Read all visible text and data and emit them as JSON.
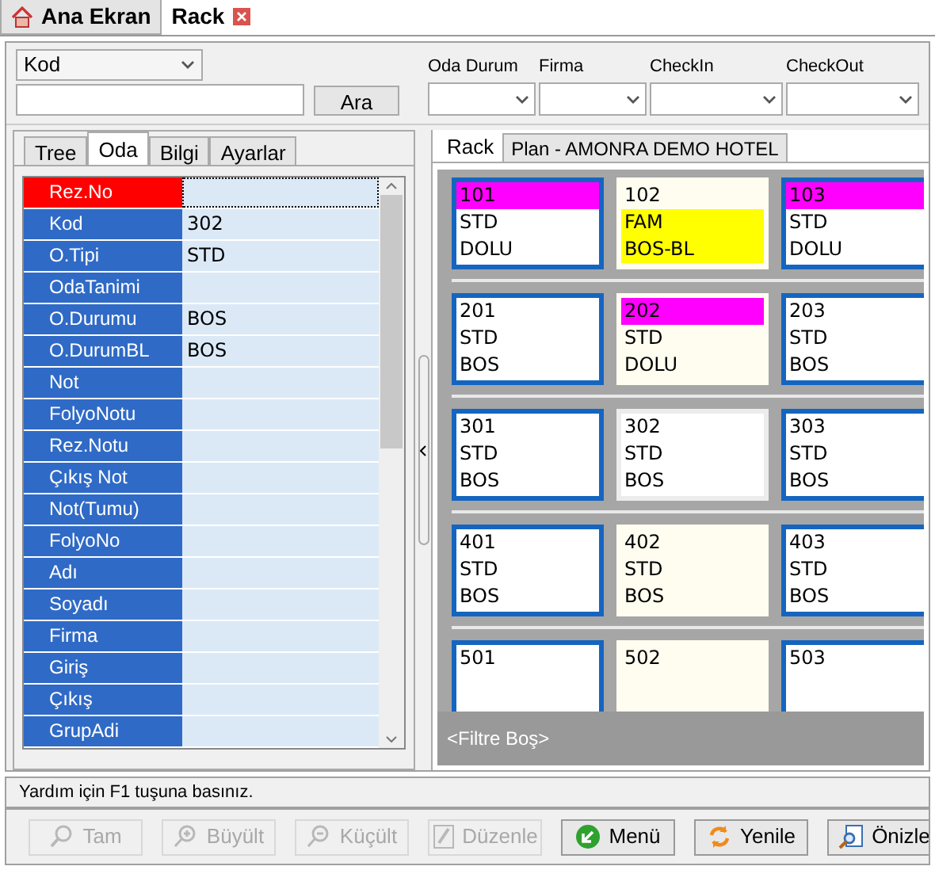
{
  "doc_tabs": [
    {
      "label": "Ana Ekran",
      "selected": false,
      "closable": false
    },
    {
      "label": "Rack",
      "selected": true,
      "closable": true
    }
  ],
  "search": {
    "field_select": "Kod",
    "button": "Ara"
  },
  "filters": [
    {
      "label": "Oda Durum"
    },
    {
      "label": "Firma"
    },
    {
      "label": "CheckIn"
    },
    {
      "label": "CheckOut"
    }
  ],
  "left_tabs": [
    {
      "label": "Tree",
      "selected": false
    },
    {
      "label": "Oda",
      "selected": true
    },
    {
      "label": "Bilgi",
      "selected": false
    },
    {
      "label": "Ayarlar",
      "selected": false
    }
  ],
  "properties": [
    {
      "label": "Rez.No",
      "selected": true
    },
    {
      "label": "Kod",
      "value": "302",
      "selected": false
    },
    {
      "label": "O.Tipi",
      "value": "STD",
      "selected": false
    },
    {
      "label": "OdaTanimi",
      "selected": false
    },
    {
      "label": "O.Durumu",
      "value": "BOS",
      "selected": false
    },
    {
      "label": "O.DurumBL",
      "value": "BOS",
      "selected": false
    },
    {
      "label": "Not",
      "selected": false
    },
    {
      "label": "FolyoNotu",
      "selected": false
    },
    {
      "label": "Rez.Notu",
      "selected": false
    },
    {
      "label": "Çıkış Not",
      "selected": false
    },
    {
      "label": "Not(Tumu)",
      "selected": false
    },
    {
      "label": "FolyoNo",
      "selected": false
    },
    {
      "label": "Adı",
      "selected": false
    },
    {
      "label": "Soyadı",
      "selected": false
    },
    {
      "label": "Firma",
      "selected": false
    },
    {
      "label": "Giriş",
      "selected": false
    },
    {
      "label": "Çıkış",
      "selected": false
    },
    {
      "label": "GrupAdi",
      "selected": false
    }
  ],
  "right_tabs": [
    {
      "label": "Rack",
      "selected": true
    },
    {
      "label": "Plan - AMONRA DEMO HOTEL",
      "selected": false
    }
  ],
  "rooms": [
    [
      {
        "number": "101",
        "type": "STD",
        "status": "DOLU",
        "occupied": true,
        "blocked": false,
        "framed": true,
        "selected": false
      },
      {
        "number": "102",
        "type": "FAM",
        "status": "BOS-BL",
        "occupied": false,
        "blocked": true,
        "framed": false,
        "selected": false
      },
      {
        "number": "103",
        "type": "STD",
        "status": "DOLU",
        "occupied": true,
        "blocked": false,
        "framed": true,
        "selected": false
      }
    ],
    [
      {
        "number": "201",
        "type": "STD",
        "status": "BOS",
        "occupied": false,
        "blocked": false,
        "framed": true,
        "selected": false
      },
      {
        "number": "202",
        "type": "STD",
        "status": "DOLU",
        "occupied": true,
        "blocked": false,
        "framed": false,
        "selected": false
      },
      {
        "number": "203",
        "type": "STD",
        "status": "BOS",
        "occupied": false,
        "blocked": false,
        "framed": true,
        "selected": false
      }
    ],
    [
      {
        "number": "301",
        "type": "STD",
        "status": "BOS",
        "occupied": false,
        "blocked": false,
        "framed": true,
        "selected": false
      },
      {
        "number": "302",
        "type": "STD",
        "status": "BOS",
        "occupied": false,
        "blocked": false,
        "framed": false,
        "selected": true
      },
      {
        "number": "303",
        "type": "STD",
        "status": "BOS",
        "occupied": false,
        "blocked": false,
        "framed": true,
        "selected": false
      }
    ],
    [
      {
        "number": "401",
        "type": "STD",
        "status": "BOS",
        "occupied": false,
        "blocked": false,
        "framed": true,
        "selected": false
      },
      {
        "number": "402",
        "type": "STD",
        "status": "BOS",
        "occupied": false,
        "blocked": false,
        "framed": false,
        "selected": false
      },
      {
        "number": "403",
        "type": "STD",
        "status": "BOS",
        "occupied": false,
        "blocked": false,
        "framed": true,
        "selected": false
      }
    ],
    [
      {
        "number": "501",
        "occupied": false,
        "framed": true,
        "selected": false
      },
      {
        "number": "502",
        "occupied": false,
        "framed": false,
        "selected": false
      },
      {
        "number": "503",
        "occupied": false,
        "framed": true,
        "selected": false
      }
    ]
  ],
  "filter_text": "<Filtre Boş>",
  "status_bar": "Yardım için F1 tuşuna basınız.",
  "buttons": [
    {
      "label": "Tam",
      "kind": "zoom",
      "disabled": true
    },
    {
      "label": "Büyült",
      "kind": "zoomin",
      "disabled": true
    },
    {
      "label": "Küçült",
      "kind": "zoomout",
      "disabled": true
    },
    {
      "label": "Düzenle",
      "kind": "edit",
      "disabled": true
    },
    {
      "label": "Menü",
      "kind": "menu",
      "disabled": false
    },
    {
      "label": "Yenile",
      "kind": "refresh",
      "disabled": false
    },
    {
      "label": "Önizle",
      "kind": "preview",
      "disabled": false
    }
  ]
}
